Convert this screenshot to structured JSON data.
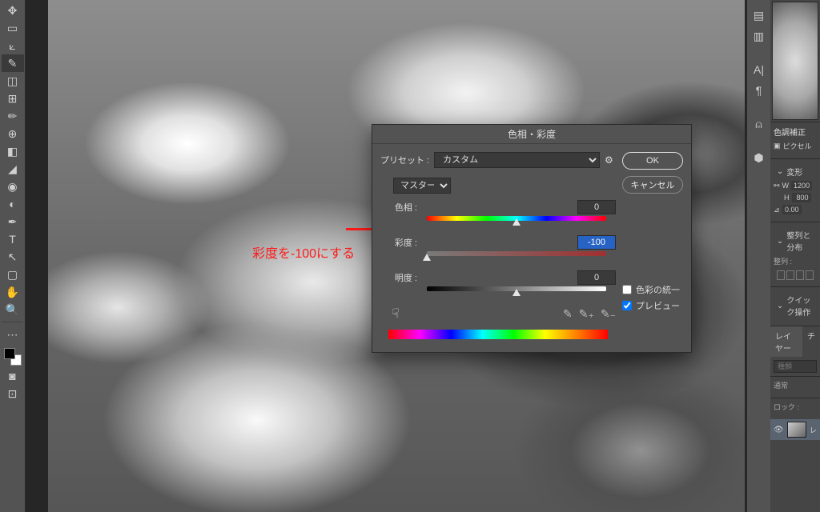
{
  "dialog": {
    "title": "色相・彩度",
    "preset_label": "プリセット :",
    "preset_value": "カスタム",
    "master": "マスター",
    "hue_label": "色相 :",
    "hue_value": "0",
    "sat_label": "彩度 :",
    "sat_value": "-100",
    "light_label": "明度 :",
    "light_value": "0",
    "colorize_label": "色彩の統一",
    "preview_label": "プレビュー",
    "ok": "OK",
    "cancel": "キャンセル"
  },
  "annotation": "彩度を-100にする",
  "right": {
    "correction": "色調補正",
    "pixel": "ピクセル",
    "transform": "変形",
    "W": "W",
    "width": "1200",
    "H": "H",
    "height": "800",
    "angle": "0.00",
    "align_dist": "整列と分布",
    "align": "整列 :",
    "quick": "クイック操作",
    "layers_tab": "レイヤー",
    "channels_tab": "チ",
    "search_ph": "種類",
    "blend": "通常",
    "lock": "ロック :",
    "layer_name": "レ"
  }
}
